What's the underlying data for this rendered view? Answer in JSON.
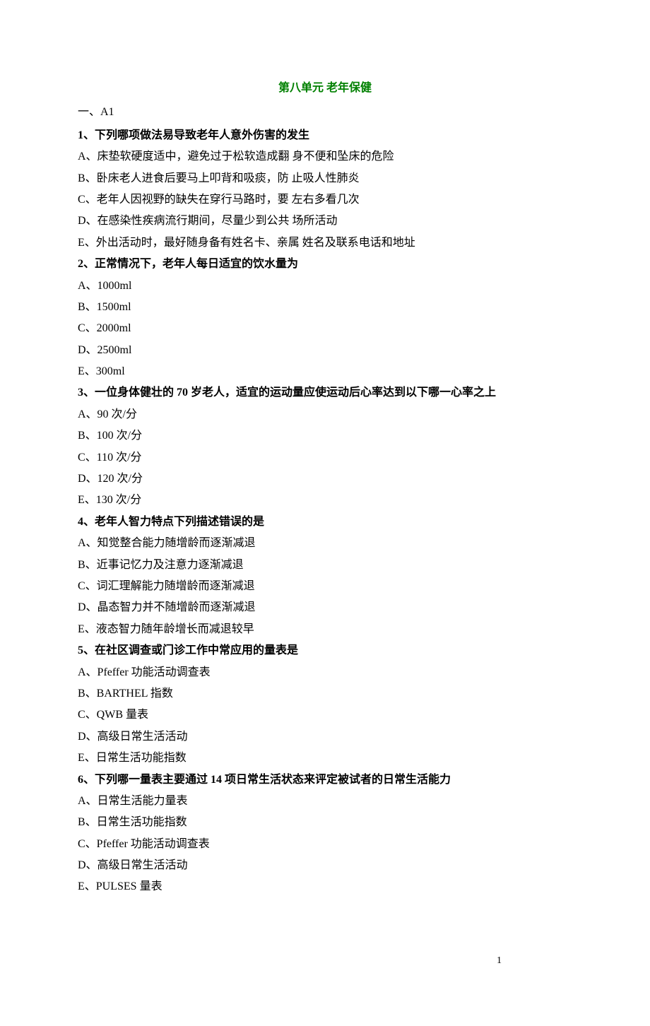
{
  "title": "第八单元 老年保健",
  "section_label": "一、A1",
  "questions": [
    {
      "stem": "1、下列哪项做法易导致老年人意外伤害的发生",
      "options": [
        "A、床垫软硬度适中，避免过于松软造成翻 身不便和坠床的危险",
        "B、卧床老人进食后要马上叩背和吸痰，防 止吸人性肺炎",
        "C、老年人因视野的缺失在穿行马路时，要 左右多看几次",
        "D、在感染性疾病流行期间，尽量少到公共 场所活动",
        "E、外出活动时，最好随身备有姓名卡、亲属 姓名及联系电话和地址"
      ]
    },
    {
      "stem": "2、正常情况下，老年人每日适宜的饮水量为",
      "options": [
        "A、1000ml",
        "B、1500ml",
        "C、2000ml",
        "D、2500ml",
        "E、300ml"
      ]
    },
    {
      "stem": "3、一位身体健壮的 70 岁老人，适宜的运动量应使运动后心率达到以下哪一心率之上",
      "options": [
        "A、90 次/分",
        "B、100 次/分",
        "C、110 次/分",
        "D、120 次/分",
        "E、130 次/分"
      ]
    },
    {
      "stem": "4、老年人智力特点下列描述错误的是",
      "options": [
        "A、知觉整合能力随增龄而逐渐减退",
        "B、近事记忆力及注意力逐渐减退",
        "C、词汇理解能力随增龄而逐渐减退",
        "D、晶态智力并不随增龄而逐渐减退",
        "E、液态智力随年龄增长而减退较早"
      ]
    },
    {
      "stem": "5、在社区调查或门诊工作中常应用的量表是",
      "options": [
        "A、Pfeffer 功能活动调查表",
        "B、BARTHEL 指数",
        "C、QWB 量表",
        "D、高级日常生活活动",
        "E、日常生活功能指数"
      ]
    },
    {
      "stem": "6、下列哪一量表主要通过 14 项日常生活状态来评定被试者的日常生活能力",
      "options": [
        "A、日常生活能力量表",
        "B、日常生活功能指数",
        "C、Pfeffer 功能活动调查表",
        "D、高级日常生活活动",
        "E、PULSES 量表"
      ]
    }
  ],
  "page_number": "1"
}
